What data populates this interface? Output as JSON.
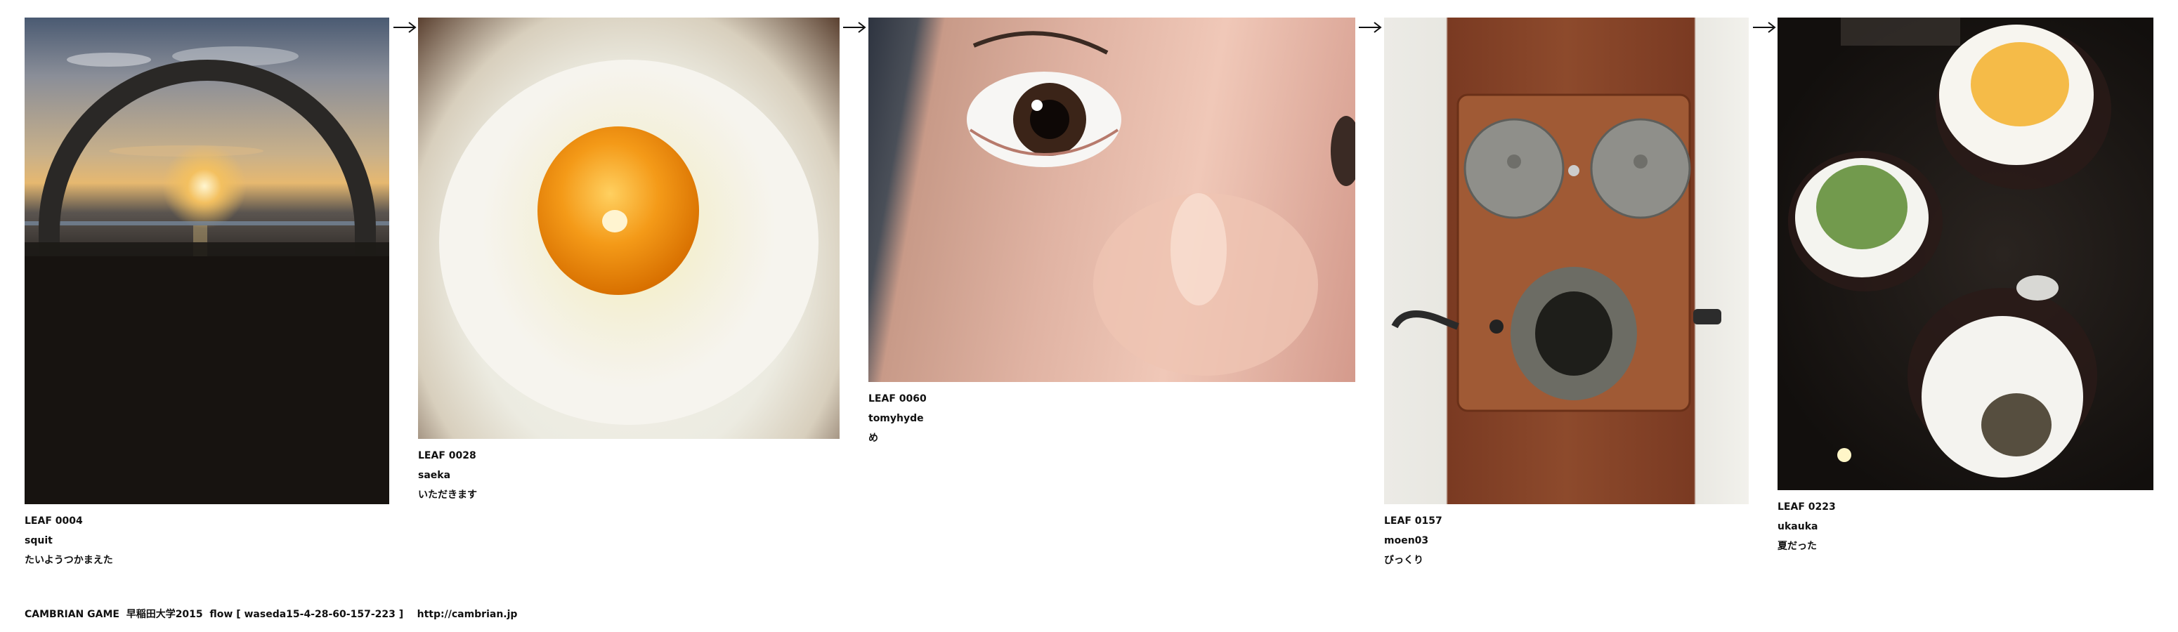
{
  "leaves": [
    {
      "id": "LEAF 0004",
      "user": "squit",
      "comment": "たいようつかまえた",
      "image_icon": "sunset-arch-photo"
    },
    {
      "id": "LEAF 0028",
      "user": "saeka",
      "comment": "いただきます",
      "image_icon": "egg-rice-photo"
    },
    {
      "id": "LEAF 0060",
      "user": "tomyhyde",
      "comment": "め",
      "image_icon": "eye-closeup-photo"
    },
    {
      "id": "LEAF 0157",
      "user": "moen03",
      "comment": "びっくり",
      "image_icon": "old-telephone-photo"
    },
    {
      "id": "LEAF 0223",
      "user": "ukauka",
      "comment": "夏だった",
      "image_icon": "shaved-ice-photo"
    }
  ],
  "arrow_icon": "right-arrow-icon",
  "footer": {
    "text": "CAMBRIAN GAME  早稲田大学2015  flow [ waseda15-4-28-60-157-223 ]    http://cambrian.jp"
  }
}
